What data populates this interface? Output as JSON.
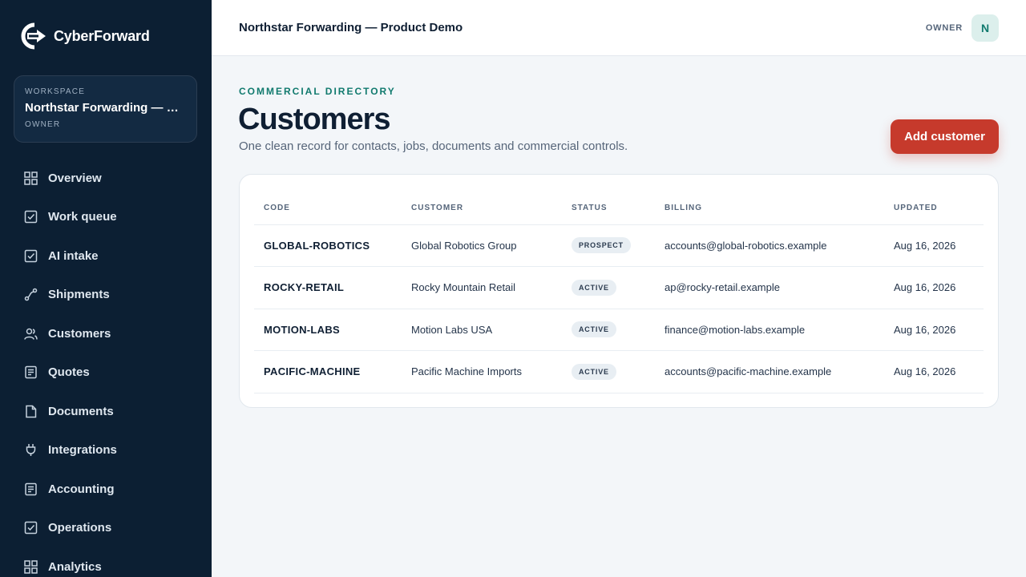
{
  "brand": {
    "name": "CyberForward"
  },
  "workspace": {
    "label": "WORKSPACE",
    "name": "Northstar Forwarding — Product Demo",
    "role": "OWNER"
  },
  "nav": {
    "items": [
      {
        "label": "Overview",
        "icon": "grid-icon"
      },
      {
        "label": "Work queue",
        "icon": "checkbox-icon"
      },
      {
        "label": "AI intake",
        "icon": "checkbox-icon"
      },
      {
        "label": "Shipments",
        "icon": "route-icon"
      },
      {
        "label": "Customers",
        "icon": "users-icon"
      },
      {
        "label": "Quotes",
        "icon": "document-lines-icon"
      },
      {
        "label": "Documents",
        "icon": "file-icon"
      },
      {
        "label": "Integrations",
        "icon": "plug-icon"
      },
      {
        "label": "Accounting",
        "icon": "document-lines-icon"
      },
      {
        "label": "Operations",
        "icon": "checkbox-icon"
      },
      {
        "label": "Analytics",
        "icon": "grid-icon"
      }
    ]
  },
  "topbar": {
    "title": "Northstar Forwarding — Product Demo",
    "role": "OWNER",
    "avatar_initial": "N"
  },
  "main": {
    "eyebrow": "COMMERCIAL DIRECTORY",
    "title": "Customers",
    "subtitle": "One clean record for contacts, jobs, documents and commercial controls.",
    "add_button": "Add customer"
  },
  "table": {
    "columns": [
      "CODE",
      "CUSTOMER",
      "STATUS",
      "BILLING",
      "UPDATED"
    ],
    "rows": [
      {
        "code": "GLOBAL-ROBOTICS",
        "customer": "Global Robotics Group",
        "status": "PROSPECT",
        "billing": "accounts@global-robotics.example",
        "updated": "Aug 16, 2026"
      },
      {
        "code": "ROCKY-RETAIL",
        "customer": "Rocky Mountain Retail",
        "status": "ACTIVE",
        "billing": "ap@rocky-retail.example",
        "updated": "Aug 16, 2026"
      },
      {
        "code": "MOTION-LABS",
        "customer": "Motion Labs USA",
        "status": "ACTIVE",
        "billing": "finance@motion-labs.example",
        "updated": "Aug 16, 2026"
      },
      {
        "code": "PACIFIC-MACHINE",
        "customer": "Pacific Machine Imports",
        "status": "ACTIVE",
        "billing": "accounts@pacific-machine.example",
        "updated": "Aug 16, 2026"
      }
    ]
  },
  "colors": {
    "sidebar": "#0c1f33",
    "accent": "#117a6e",
    "primary_button": "#c63a2c"
  }
}
